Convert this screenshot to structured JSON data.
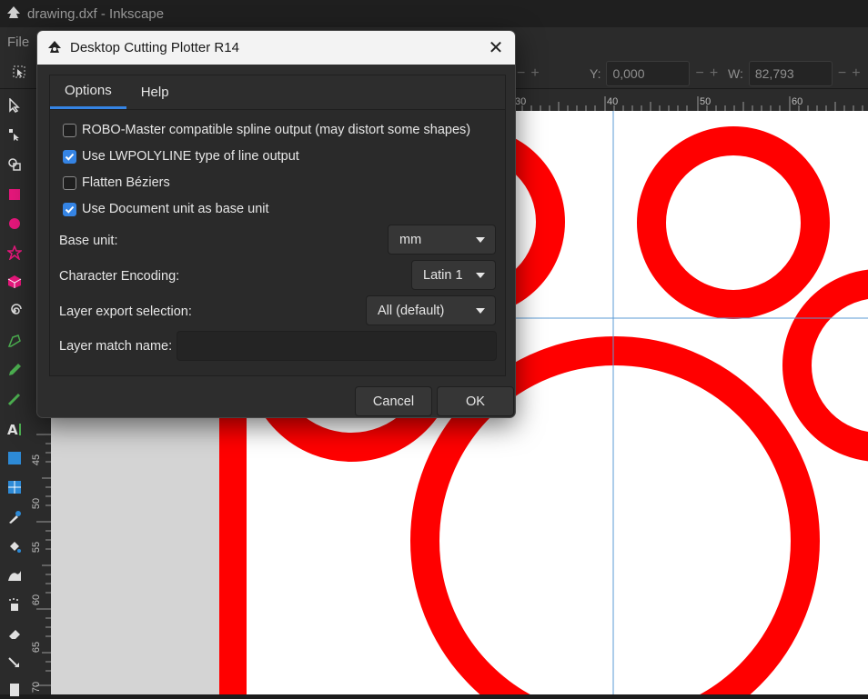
{
  "window": {
    "title": "drawing.dxf - Inkscape"
  },
  "menubar": {
    "items": [
      "File"
    ]
  },
  "toolcontrols": {
    "y_label": "Y:",
    "y_value": "0,000",
    "w_label": "W:",
    "w_value": "82,793"
  },
  "rulers": {
    "h_ticks": [
      "30",
      "40",
      "50",
      "60"
    ],
    "v_ticks": [
      "45",
      "50",
      "55",
      "60",
      "65",
      "70"
    ]
  },
  "tools": [
    "selector-icon",
    "node-icon",
    "tweak-icon",
    "rect-icon",
    "circle-icon",
    "star-icon",
    "box3d-icon",
    "spiral-icon",
    "pen-icon",
    "pencil-icon",
    "calligraphy-icon",
    "text-icon",
    "gradient-icon",
    "mesh-icon",
    "dropper-icon",
    "paintbucket-icon",
    "eraser-icon",
    "spray-icon",
    "measure-icon",
    "connector-icon",
    "page-icon"
  ],
  "dialog": {
    "title": "Desktop Cutting Plotter R14",
    "close_glyph": "✕",
    "tabs": [
      {
        "label": "Options",
        "active": true
      },
      {
        "label": "Help",
        "active": false
      }
    ],
    "options": [
      {
        "label": "ROBO-Master compatible spline output (may distort some shapes)",
        "checked": false
      },
      {
        "label": "Use LWPOLYLINE type of line output",
        "checked": true
      },
      {
        "label": "Flatten Béziers",
        "checked": false
      },
      {
        "label": "Use Document unit as base unit",
        "checked": true
      }
    ],
    "base_unit": {
      "label": "Base unit:",
      "value": "mm"
    },
    "encoding": {
      "label": "Character Encoding:",
      "value": "Latin 1"
    },
    "layer_export": {
      "label": "Layer export selection:",
      "value": "All (default)"
    },
    "layer_match": {
      "label": "Layer match name:",
      "value": ""
    },
    "cancel_label": "Cancel",
    "ok_label": "OK"
  },
  "colors": {
    "accent": "#3584e4",
    "shape_red": "#ff0000",
    "guide": "#5b9bd5"
  }
}
